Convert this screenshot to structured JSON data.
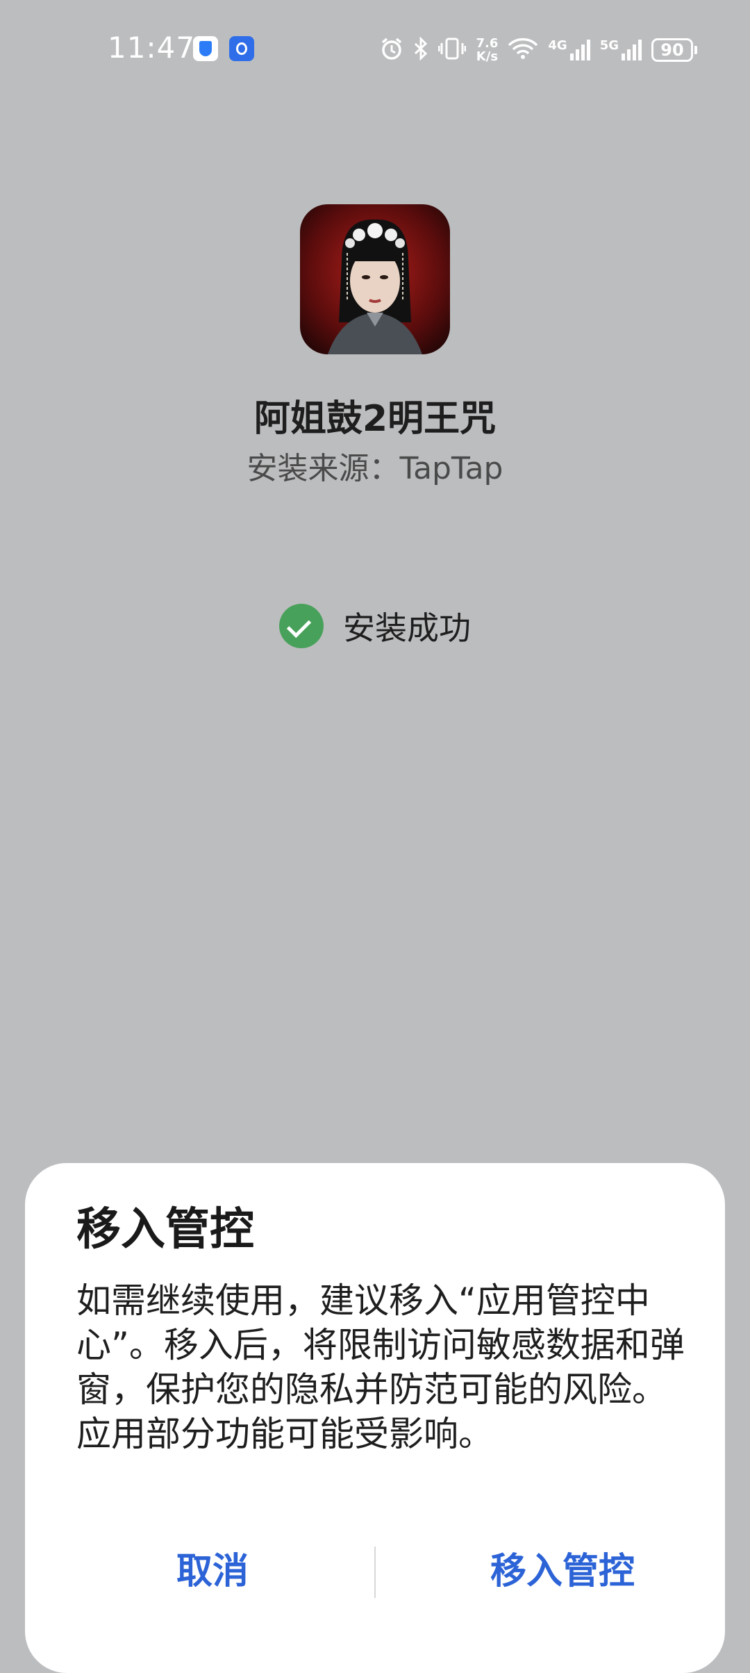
{
  "status_bar": {
    "time": "11:47",
    "net_speed_value": "7.6",
    "net_speed_unit": "K/s",
    "signal_1": "4G",
    "signal_2": "5G",
    "battery": "90",
    "icons": [
      "shield-icon",
      "app-notification-icon",
      "alarm-icon",
      "bluetooth-icon",
      "vibrate-icon",
      "wifi-icon",
      "signal-4g-icon",
      "signal-5g-icon",
      "battery-icon"
    ]
  },
  "app": {
    "name": "阿姐鼓2明王咒",
    "source": "安装来源：TapTap",
    "icon": "app-icon-portrait"
  },
  "install": {
    "status": "安装成功",
    "status_color": "#48a15a"
  },
  "dialog": {
    "title": "移入管控",
    "body": "如需继续使用，建议移入“应用管控中心”。移入后，将限制访问敏感数据和弹窗，保护您的隐私并防范可能的风险。应用部分功能可能受影响。",
    "cancel_label": "取消",
    "confirm_label": "移入管控",
    "accent_color": "#2c63d6"
  }
}
